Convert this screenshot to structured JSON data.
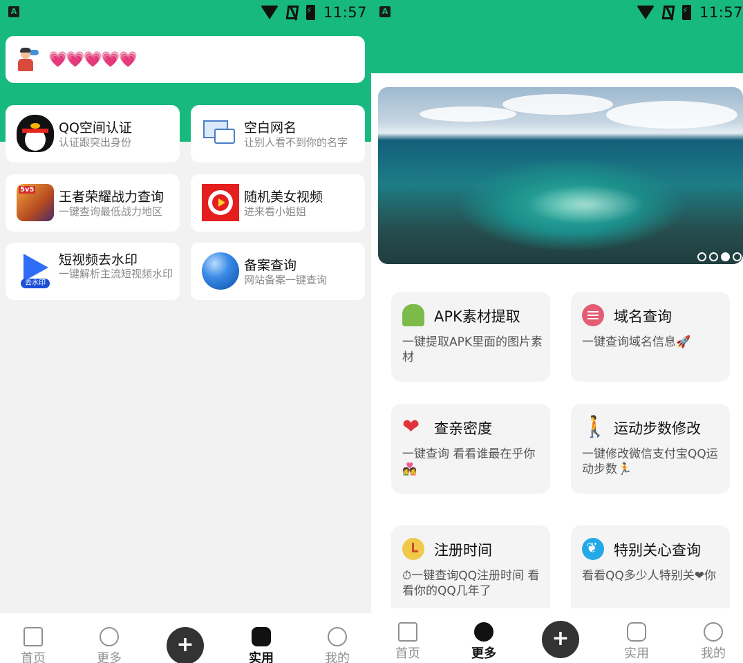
{
  "status_bar": {
    "time": "11:57",
    "indicator": "A"
  },
  "left_screen": {
    "hearts": "💗💗💗💗💗",
    "cards": [
      {
        "title": "QQ空间认证",
        "desc": "认证跟突出身份",
        "icon": "qq-penguin-icon"
      },
      {
        "title": "空白网名",
        "desc": "让别人看不到你的名字",
        "icon": "message-envelope-icon"
      },
      {
        "title": "王者荣耀战力查询",
        "desc": "一键查询最低战力地区",
        "icon": "game-hero-icon",
        "icon_badge": "5v5"
      },
      {
        "title": "随机美女视频",
        "desc": "进来看小姐姐",
        "icon": "video-play-icon"
      },
      {
        "title": "短视频去水印",
        "desc": "一键解析主流短视频水印",
        "icon": "watermark-remove-icon",
        "icon_label": "去水印"
      },
      {
        "title": "备案查询",
        "desc": "网站备案一键查询",
        "icon": "globe-icon"
      }
    ],
    "nav": [
      {
        "label": "首页",
        "icon": "home-icon"
      },
      {
        "label": "更多",
        "icon": "compass-icon"
      },
      {
        "label": "",
        "icon": "plus-icon"
      },
      {
        "label": "实用",
        "icon": "chat-icon",
        "active": true
      },
      {
        "label": "我的",
        "icon": "user-icon"
      }
    ]
  },
  "right_screen": {
    "banner": {
      "pages": 4,
      "active_page": 3
    },
    "cards": [
      {
        "title": "APK素材提取",
        "desc": "一键提取APK里面的图片素材",
        "icon": "android-icon"
      },
      {
        "title": "域名查询",
        "desc": "一键查询域名信息🚀",
        "icon": "domain-list-icon"
      },
      {
        "title": "查亲密度",
        "desc": "一键查询 看看谁最在乎你💑",
        "icon": "heart-icon"
      },
      {
        "title": "运动步数修改",
        "desc": "一键修改微信支付宝QQ运动步数🏃",
        "icon": "walking-icon"
      },
      {
        "title": "注册时间",
        "desc": "⏱一键查询QQ注册时间 看看你的QQ几年了",
        "icon": "clock-icon"
      },
      {
        "title": "特别关心查询",
        "desc": "看看QQ多少人特别关❤你",
        "icon": "care-icon"
      }
    ],
    "nav": [
      {
        "label": "首页",
        "icon": "home-icon"
      },
      {
        "label": "更多",
        "icon": "compass-icon",
        "active": true
      },
      {
        "label": "",
        "icon": "plus-icon"
      },
      {
        "label": "实用",
        "icon": "chat-icon"
      },
      {
        "label": "我的",
        "icon": "user-icon"
      }
    ]
  },
  "colors": {
    "brand_green": "#18b97f",
    "card_bg": "#ffffff",
    "page_bg": "#f2f2f2"
  }
}
